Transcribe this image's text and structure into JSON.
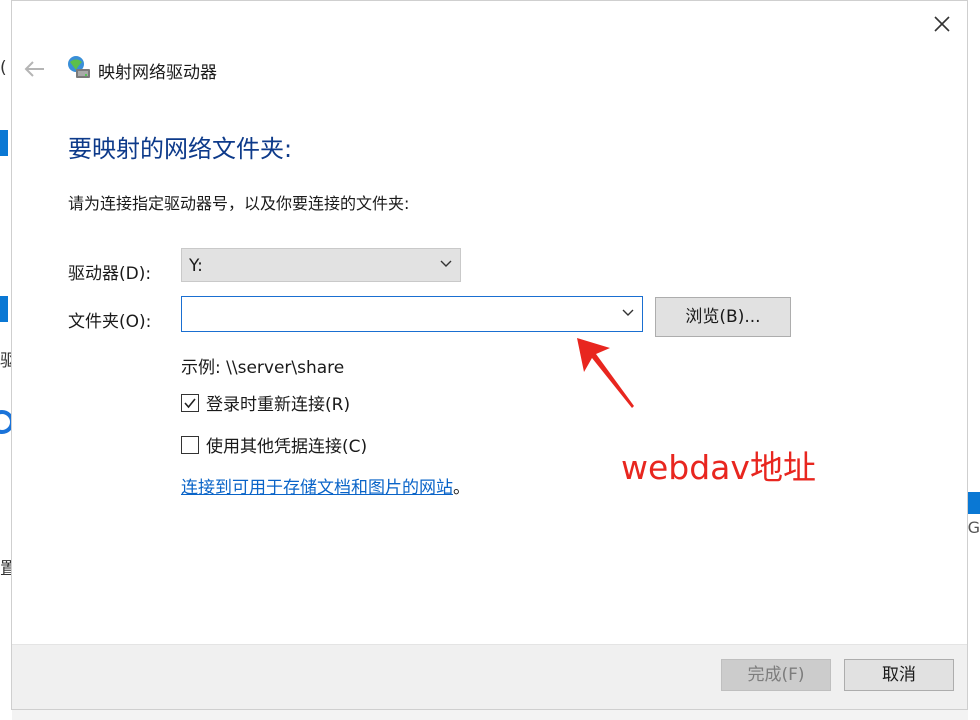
{
  "background": {
    "left_fragments": [
      "(",
      "驱",
      "置"
    ],
    "right_fragment": "G"
  },
  "dialog": {
    "title": "映射网络驱动器",
    "heading": "要映射的网络文件夹:",
    "instruction": "请为连接指定驱动器号，以及你要连接的文件夹:",
    "drive_label": "驱动器(D):",
    "drive_value": "Y:",
    "folder_label": "文件夹(O):",
    "folder_value": "",
    "folder_placeholder": "",
    "browse_label": "浏览(B)...",
    "example_text": "示例: \\\\server\\share",
    "reconnect_label": "登录时重新连接(R)",
    "reconnect_checked": true,
    "other_credentials_label": "使用其他凭据连接(C)",
    "other_credentials_checked": false,
    "link_text": "连接到可用于存储文档和图片的网站",
    "link_suffix": "。"
  },
  "footer": {
    "finish_label": "完成(F)",
    "cancel_label": "取消"
  },
  "annotation": {
    "text": "webdav地址",
    "color": "#e8261f"
  },
  "colors": {
    "heading": "#0d3a8a",
    "link": "#0a64c8",
    "focus_border": "#1a6fd1"
  }
}
